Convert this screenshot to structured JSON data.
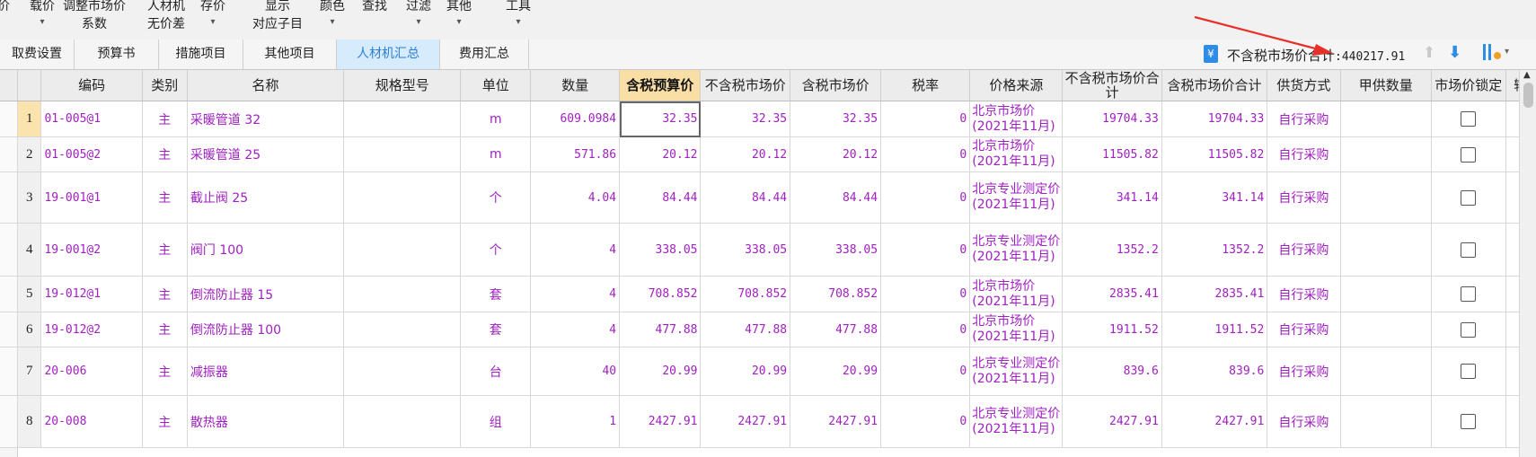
{
  "ribbon": {
    "items": [
      {
        "key": "frag",
        "l1": "价",
        "l2": "",
        "arrow": false
      },
      {
        "key": "zaijia",
        "l1": "载价",
        "l2": "",
        "arrow": true
      },
      {
        "key": "adjust",
        "l1": "调整市场价",
        "l2": "系数",
        "arrow": false
      },
      {
        "key": "rencaiji",
        "l1": "人材机",
        "l2": "无价差",
        "arrow": false
      },
      {
        "key": "store",
        "l1": "存价",
        "l2": "",
        "arrow": true
      },
      {
        "key": "display",
        "l1": "显示",
        "l2": "对应子目",
        "arrow": false
      },
      {
        "key": "color",
        "l1": "颜色",
        "l2": "",
        "arrow": true
      },
      {
        "key": "find",
        "l1": "查找",
        "l2": "",
        "arrow": false
      },
      {
        "key": "filter",
        "l1": "过滤",
        "l2": "",
        "arrow": true
      },
      {
        "key": "other",
        "l1": "其他",
        "l2": "",
        "arrow": true
      },
      {
        "key": "tools",
        "l1": "工具",
        "l2": "",
        "arrow": true
      }
    ]
  },
  "tabs": [
    {
      "label": "取费设置",
      "active": false
    },
    {
      "label": "预算书",
      "active": false
    },
    {
      "label": "措施项目",
      "active": false
    },
    {
      "label": "其他项目",
      "active": false
    },
    {
      "label": "人材机汇总",
      "active": true
    },
    {
      "label": "费用汇总",
      "active": false
    }
  ],
  "summary": {
    "icon": "yuan-icon",
    "label": "不含税市场价合计",
    "value": ":440217.91"
  },
  "colors": {
    "accent": "#2d8ce6",
    "cell_text": "#a020c0",
    "highlight_header": "#f9dfa6",
    "annotation": "#e8302a"
  },
  "columns": [
    "编码",
    "类别",
    "名称",
    "规格型号",
    "单位",
    "数量",
    "含税预算价",
    "不含税市场价",
    "含税市场价",
    "税率",
    "价格来源",
    "不含税市场价合计",
    "含税市场价合计",
    "供货方式",
    "甲供数量",
    "市场价锁定",
    "输"
  ],
  "rows": [
    {
      "no": "1",
      "code": "01-005@1",
      "type": "主",
      "name": "采暖管道 32",
      "spec": "",
      "unit": "m",
      "qty": "609.0984",
      "budget": "32.35",
      "market_ex": "32.35",
      "market_in": "32.35",
      "tax": "0",
      "source": "北京市场价(2021年11月)",
      "total_ex": "19704.33",
      "total_in": "19704.33",
      "supply": "自行采购",
      "jia": "",
      "lock": false
    },
    {
      "no": "2",
      "code": "01-005@2",
      "type": "主",
      "name": "采暖管道 25",
      "spec": "",
      "unit": "m",
      "qty": "571.86",
      "budget": "20.12",
      "market_ex": "20.12",
      "market_in": "20.12",
      "tax": "0",
      "source": "北京市场价(2021年11月)",
      "total_ex": "11505.82",
      "total_in": "11505.82",
      "supply": "自行采购",
      "jia": "",
      "lock": false
    },
    {
      "no": "3",
      "code": "19-001@1",
      "type": "主",
      "name": "截止阀 25",
      "spec": "",
      "unit": "个",
      "qty": "4.04",
      "budget": "84.44",
      "market_ex": "84.44",
      "market_in": "84.44",
      "tax": "0",
      "source": "北京专业测定价(2021年11月)",
      "total_ex": "341.14",
      "total_in": "341.14",
      "supply": "自行采购",
      "jia": "",
      "lock": false
    },
    {
      "no": "4",
      "code": "19-001@2",
      "type": "主",
      "name": "阀门 100",
      "spec": "",
      "unit": "个",
      "qty": "4",
      "budget": "338.05",
      "market_ex": "338.05",
      "market_in": "338.05",
      "tax": "0",
      "source": "北京专业测定价(2021年11月)",
      "total_ex": "1352.2",
      "total_in": "1352.2",
      "supply": "自行采购",
      "jia": "",
      "lock": false
    },
    {
      "no": "5",
      "code": "19-012@1",
      "type": "主",
      "name": "倒流防止器 15",
      "spec": "",
      "unit": "套",
      "qty": "4",
      "budget": "708.852",
      "market_ex": "708.852",
      "market_in": "708.852",
      "tax": "0",
      "source": "北京市场价(2021年11月)",
      "total_ex": "2835.41",
      "total_in": "2835.41",
      "supply": "自行采购",
      "jia": "",
      "lock": false
    },
    {
      "no": "6",
      "code": "19-012@2",
      "type": "主",
      "name": "倒流防止器 100",
      "spec": "",
      "unit": "套",
      "qty": "4",
      "budget": "477.88",
      "market_ex": "477.88",
      "market_in": "477.88",
      "tax": "0",
      "source": "北京市场价(2021年11月)",
      "total_ex": "1911.52",
      "total_in": "1911.52",
      "supply": "自行采购",
      "jia": "",
      "lock": false
    },
    {
      "no": "7",
      "code": "20-006",
      "type": "主",
      "name": "减振器",
      "spec": "",
      "unit": "台",
      "qty": "40",
      "budget": "20.99",
      "market_ex": "20.99",
      "market_in": "20.99",
      "tax": "0",
      "source": "北京专业测定价(2021年11月)",
      "total_ex": "839.6",
      "total_in": "839.6",
      "supply": "自行采购",
      "jia": "",
      "lock": false
    },
    {
      "no": "8",
      "code": "20-008",
      "type": "主",
      "name": "散热器",
      "spec": "",
      "unit": "组",
      "qty": "1",
      "budget": "2427.91",
      "market_ex": "2427.91",
      "market_in": "2427.91",
      "tax": "0",
      "source": "北京专业测定价(2021年11月)",
      "total_ex": "2427.91",
      "total_in": "2427.91",
      "supply": "自行采购",
      "jia": "",
      "lock": false
    }
  ]
}
